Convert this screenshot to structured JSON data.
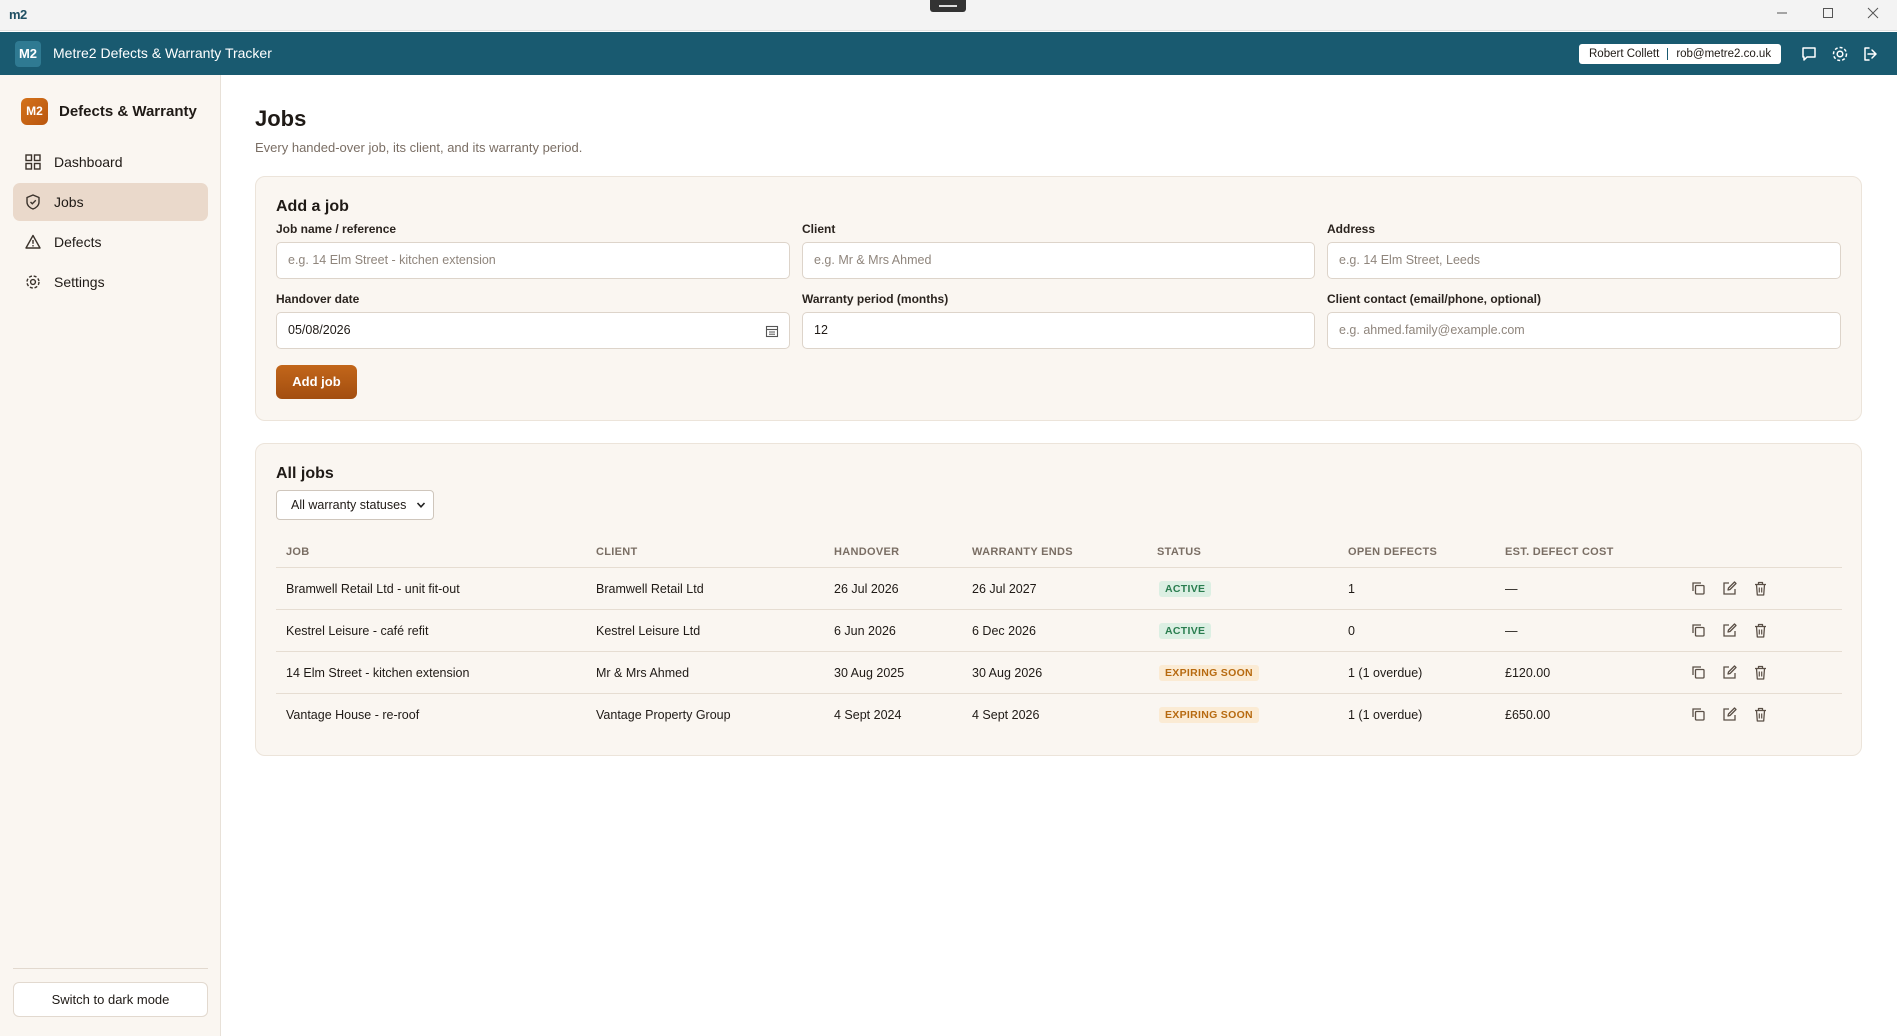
{
  "os": {
    "logo": "m2",
    "logo_sup": "2"
  },
  "header": {
    "badge": "M2",
    "title": "Metre2 Defects & Warranty Tracker",
    "user_name": "Robert Collett",
    "user_email": "rob@metre2.co.uk",
    "icons": [
      "chat-icon",
      "gear-icon",
      "logout-icon"
    ]
  },
  "sidebar": {
    "badge": "M2",
    "brand": "Defects & Warranty",
    "items": [
      {
        "label": "Dashboard",
        "icon": "dashboard-icon",
        "active": false
      },
      {
        "label": "Jobs",
        "icon": "shield-icon",
        "active": true
      },
      {
        "label": "Defects",
        "icon": "warning-icon",
        "active": false
      },
      {
        "label": "Settings",
        "icon": "gear-icon",
        "active": false
      }
    ],
    "dark_mode_label": "Switch to dark mode"
  },
  "page": {
    "title": "Jobs",
    "subtitle": "Every handed-over job, its client, and its warranty period."
  },
  "add_job": {
    "title": "Add a job",
    "fields": {
      "job_name": {
        "label": "Job name / reference",
        "placeholder": "e.g. 14 Elm Street - kitchen extension",
        "value": ""
      },
      "client": {
        "label": "Client",
        "placeholder": "e.g. Mr & Mrs Ahmed",
        "value": ""
      },
      "address": {
        "label": "Address",
        "placeholder": "e.g. 14 Elm Street, Leeds",
        "value": ""
      },
      "handover": {
        "label": "Handover date",
        "value": "05/08/2026"
      },
      "warranty": {
        "label": "Warranty period (months)",
        "value": "12"
      },
      "contact": {
        "label": "Client contact (email/phone, optional)",
        "placeholder": "e.g. ahmed.family@example.com",
        "value": ""
      }
    },
    "submit_label": "Add job"
  },
  "all_jobs": {
    "title": "All jobs",
    "filter_value": "All warranty statuses",
    "columns": [
      "JOB",
      "CLIENT",
      "HANDOVER",
      "WARRANTY ENDS",
      "STATUS",
      "OPEN DEFECTS",
      "EST. DEFECT COST"
    ],
    "rows": [
      {
        "job": "Bramwell Retail Ltd - unit fit-out",
        "client": "Bramwell Retail Ltd",
        "handover": "26 Jul 2026",
        "warranty_ends": "26 Jul 2027",
        "status": "ACTIVE",
        "open_defects": "1",
        "cost": "—"
      },
      {
        "job": "Kestrel Leisure - café refit",
        "client": "Kestrel Leisure Ltd",
        "handover": "6 Jun 2026",
        "warranty_ends": "6 Dec 2026",
        "status": "ACTIVE",
        "open_defects": "0",
        "cost": "—"
      },
      {
        "job": "14 Elm Street - kitchen extension",
        "client": "Mr & Mrs Ahmed",
        "handover": "30 Aug 2025",
        "warranty_ends": "30 Aug 2026",
        "status": "EXPIRING SOON",
        "open_defects": "1 (1 overdue)",
        "cost": "£120.00"
      },
      {
        "job": "Vantage House - re-roof",
        "client": "Vantage Property Group",
        "handover": "4 Sept 2024",
        "warranty_ends": "4 Sept 2026",
        "status": "EXPIRING SOON",
        "open_defects": "1 (1 overdue)",
        "cost": "£650.00"
      }
    ]
  }
}
